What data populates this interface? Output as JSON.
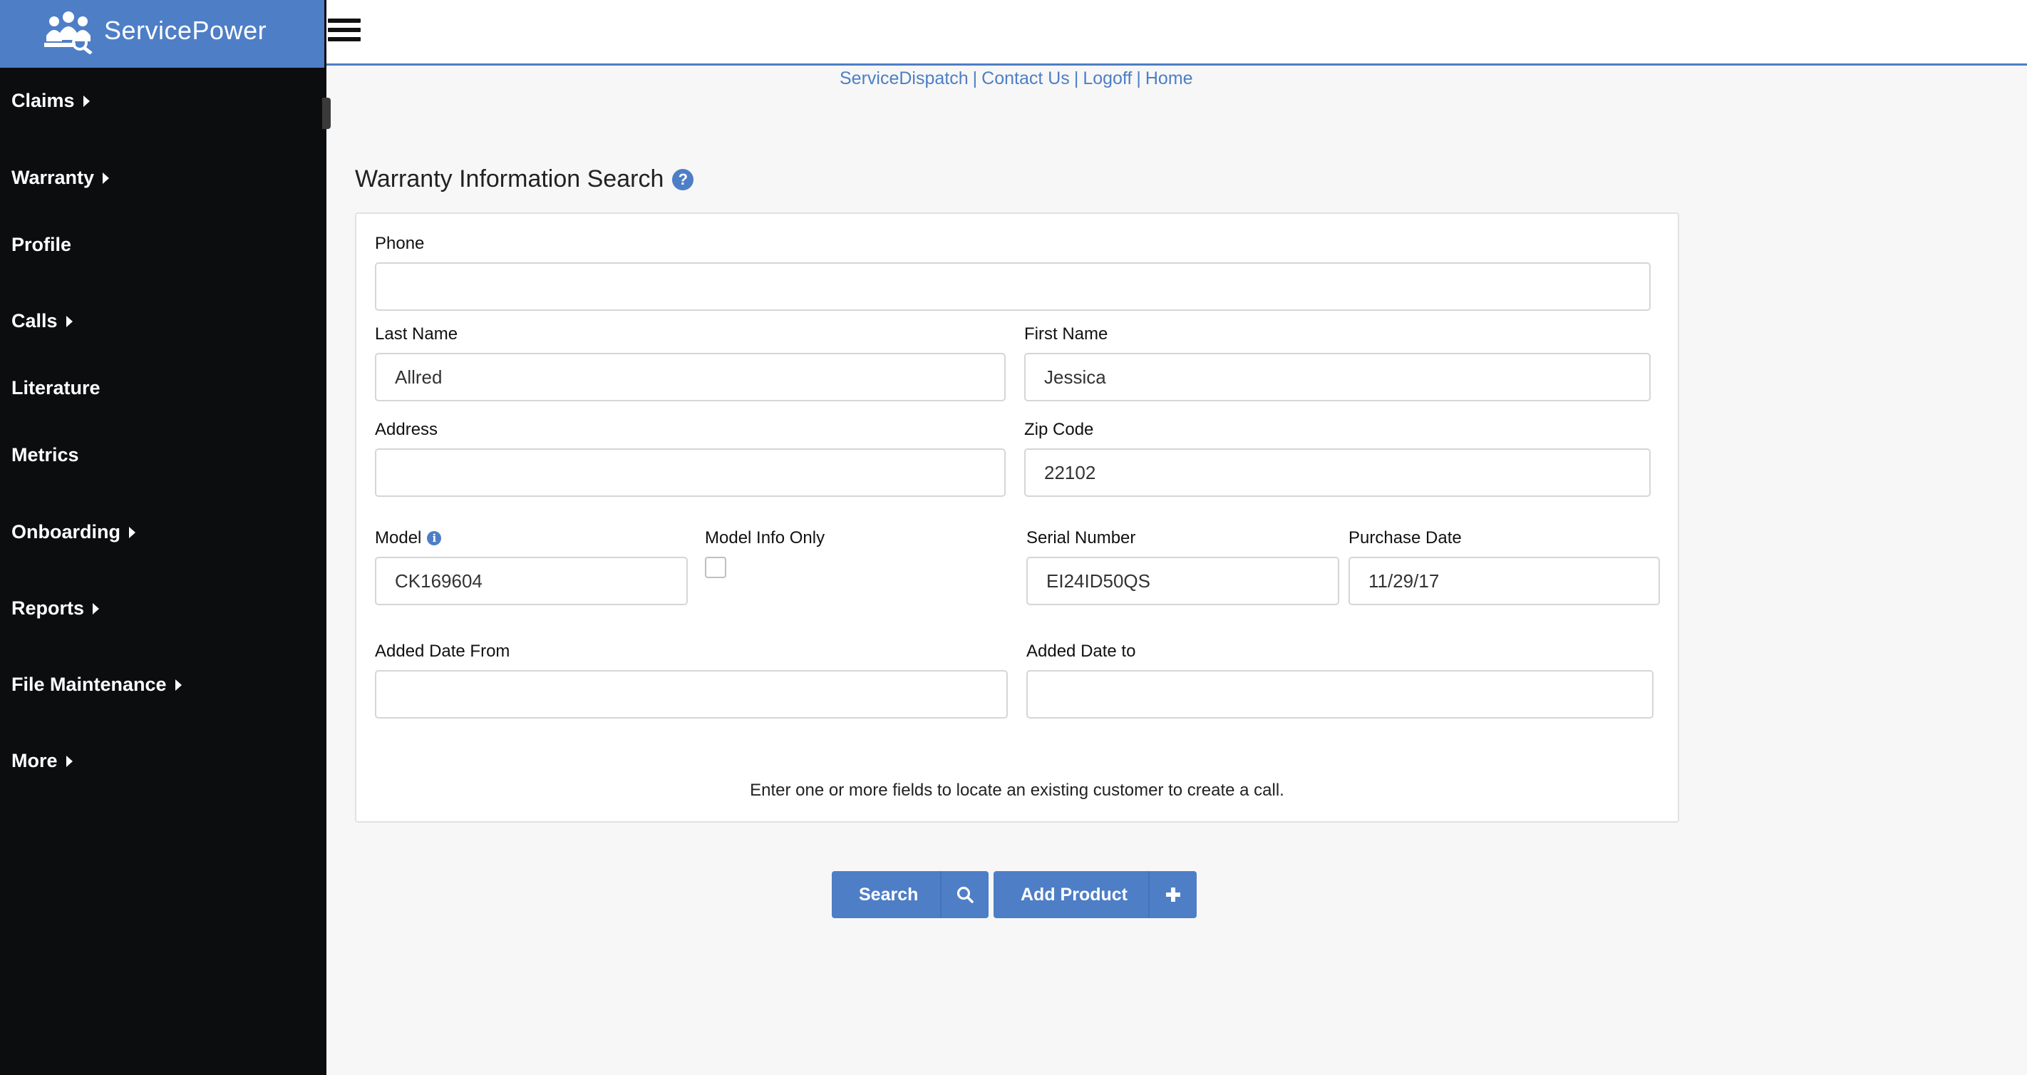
{
  "brand": {
    "name": "ServicePower"
  },
  "sidebar": {
    "items": [
      {
        "label": "Claims",
        "has_submenu": true
      },
      {
        "label": "Warranty",
        "has_submenu": true
      },
      {
        "label": "Profile",
        "has_submenu": false
      },
      {
        "label": "Calls",
        "has_submenu": true
      },
      {
        "label": "Literature",
        "has_submenu": false
      },
      {
        "label": "Metrics",
        "has_submenu": false
      },
      {
        "label": "Onboarding",
        "has_submenu": true
      },
      {
        "label": "Reports",
        "has_submenu": true
      },
      {
        "label": "File Maintenance",
        "has_submenu": true
      },
      {
        "label": "More",
        "has_submenu": true
      }
    ]
  },
  "toplinks": {
    "service_dispatch": "ServiceDispatch",
    "contact_us": "Contact Us",
    "logoff": "Logoff",
    "home": "Home",
    "separator": "|"
  },
  "page": {
    "title": "Warranty Information Search"
  },
  "form": {
    "phone": {
      "label": "Phone",
      "value": ""
    },
    "last_name": {
      "label": "Last Name",
      "value": "Allred"
    },
    "first_name": {
      "label": "First Name",
      "value": "Jessica"
    },
    "address": {
      "label": "Address",
      "value": ""
    },
    "zip_code": {
      "label": "Zip Code",
      "value": "22102"
    },
    "model": {
      "label": "Model",
      "value": "CK169604"
    },
    "model_info_only": {
      "label": "Model Info Only",
      "checked": false
    },
    "serial_number": {
      "label": "Serial Number",
      "value": "EI24ID50QS"
    },
    "purchase_date": {
      "label": "Purchase Date",
      "value": "11/29/17"
    },
    "added_date_from": {
      "label": "Added Date From",
      "value": ""
    },
    "added_date_to": {
      "label": "Added Date to",
      "value": ""
    },
    "hint": "Enter one or more fields to locate an existing customer to create a call."
  },
  "actions": {
    "search_label": "Search",
    "add_product_label": "Add Product"
  },
  "colors": {
    "accent": "#4e7ec6",
    "sidebar_bg": "#0c0d0f"
  }
}
